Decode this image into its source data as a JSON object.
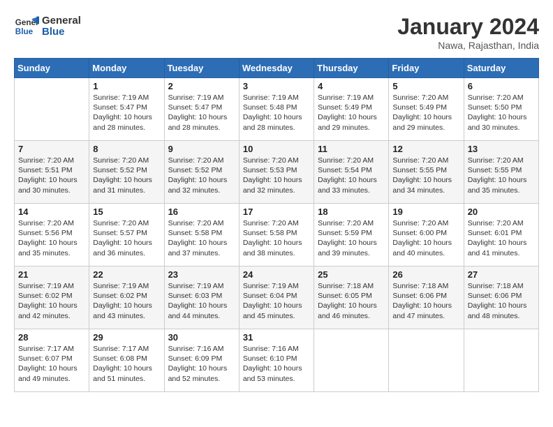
{
  "header": {
    "logo_line1": "General",
    "logo_line2": "Blue",
    "month": "January 2024",
    "location": "Nawa, Rajasthan, India"
  },
  "weekdays": [
    "Sunday",
    "Monday",
    "Tuesday",
    "Wednesday",
    "Thursday",
    "Friday",
    "Saturday"
  ],
  "weeks": [
    [
      {
        "day": "",
        "info": ""
      },
      {
        "day": "1",
        "info": "Sunrise: 7:19 AM\nSunset: 5:47 PM\nDaylight: 10 hours\nand 28 minutes."
      },
      {
        "day": "2",
        "info": "Sunrise: 7:19 AM\nSunset: 5:47 PM\nDaylight: 10 hours\nand 28 minutes."
      },
      {
        "day": "3",
        "info": "Sunrise: 7:19 AM\nSunset: 5:48 PM\nDaylight: 10 hours\nand 28 minutes."
      },
      {
        "day": "4",
        "info": "Sunrise: 7:19 AM\nSunset: 5:49 PM\nDaylight: 10 hours\nand 29 minutes."
      },
      {
        "day": "5",
        "info": "Sunrise: 7:20 AM\nSunset: 5:49 PM\nDaylight: 10 hours\nand 29 minutes."
      },
      {
        "day": "6",
        "info": "Sunrise: 7:20 AM\nSunset: 5:50 PM\nDaylight: 10 hours\nand 30 minutes."
      }
    ],
    [
      {
        "day": "7",
        "info": "Sunrise: 7:20 AM\nSunset: 5:51 PM\nDaylight: 10 hours\nand 30 minutes."
      },
      {
        "day": "8",
        "info": "Sunrise: 7:20 AM\nSunset: 5:52 PM\nDaylight: 10 hours\nand 31 minutes."
      },
      {
        "day": "9",
        "info": "Sunrise: 7:20 AM\nSunset: 5:52 PM\nDaylight: 10 hours\nand 32 minutes."
      },
      {
        "day": "10",
        "info": "Sunrise: 7:20 AM\nSunset: 5:53 PM\nDaylight: 10 hours\nand 32 minutes."
      },
      {
        "day": "11",
        "info": "Sunrise: 7:20 AM\nSunset: 5:54 PM\nDaylight: 10 hours\nand 33 minutes."
      },
      {
        "day": "12",
        "info": "Sunrise: 7:20 AM\nSunset: 5:55 PM\nDaylight: 10 hours\nand 34 minutes."
      },
      {
        "day": "13",
        "info": "Sunrise: 7:20 AM\nSunset: 5:55 PM\nDaylight: 10 hours\nand 35 minutes."
      }
    ],
    [
      {
        "day": "14",
        "info": "Sunrise: 7:20 AM\nSunset: 5:56 PM\nDaylight: 10 hours\nand 35 minutes."
      },
      {
        "day": "15",
        "info": "Sunrise: 7:20 AM\nSunset: 5:57 PM\nDaylight: 10 hours\nand 36 minutes."
      },
      {
        "day": "16",
        "info": "Sunrise: 7:20 AM\nSunset: 5:58 PM\nDaylight: 10 hours\nand 37 minutes."
      },
      {
        "day": "17",
        "info": "Sunrise: 7:20 AM\nSunset: 5:58 PM\nDaylight: 10 hours\nand 38 minutes."
      },
      {
        "day": "18",
        "info": "Sunrise: 7:20 AM\nSunset: 5:59 PM\nDaylight: 10 hours\nand 39 minutes."
      },
      {
        "day": "19",
        "info": "Sunrise: 7:20 AM\nSunset: 6:00 PM\nDaylight: 10 hours\nand 40 minutes."
      },
      {
        "day": "20",
        "info": "Sunrise: 7:20 AM\nSunset: 6:01 PM\nDaylight: 10 hours\nand 41 minutes."
      }
    ],
    [
      {
        "day": "21",
        "info": "Sunrise: 7:19 AM\nSunset: 6:02 PM\nDaylight: 10 hours\nand 42 minutes."
      },
      {
        "day": "22",
        "info": "Sunrise: 7:19 AM\nSunset: 6:02 PM\nDaylight: 10 hours\nand 43 minutes."
      },
      {
        "day": "23",
        "info": "Sunrise: 7:19 AM\nSunset: 6:03 PM\nDaylight: 10 hours\nand 44 minutes."
      },
      {
        "day": "24",
        "info": "Sunrise: 7:19 AM\nSunset: 6:04 PM\nDaylight: 10 hours\nand 45 minutes."
      },
      {
        "day": "25",
        "info": "Sunrise: 7:18 AM\nSunset: 6:05 PM\nDaylight: 10 hours\nand 46 minutes."
      },
      {
        "day": "26",
        "info": "Sunrise: 7:18 AM\nSunset: 6:06 PM\nDaylight: 10 hours\nand 47 minutes."
      },
      {
        "day": "27",
        "info": "Sunrise: 7:18 AM\nSunset: 6:06 PM\nDaylight: 10 hours\nand 48 minutes."
      }
    ],
    [
      {
        "day": "28",
        "info": "Sunrise: 7:17 AM\nSunset: 6:07 PM\nDaylight: 10 hours\nand 49 minutes."
      },
      {
        "day": "29",
        "info": "Sunrise: 7:17 AM\nSunset: 6:08 PM\nDaylight: 10 hours\nand 51 minutes."
      },
      {
        "day": "30",
        "info": "Sunrise: 7:16 AM\nSunset: 6:09 PM\nDaylight: 10 hours\nand 52 minutes."
      },
      {
        "day": "31",
        "info": "Sunrise: 7:16 AM\nSunset: 6:10 PM\nDaylight: 10 hours\nand 53 minutes."
      },
      {
        "day": "",
        "info": ""
      },
      {
        "day": "",
        "info": ""
      },
      {
        "day": "",
        "info": ""
      }
    ]
  ]
}
